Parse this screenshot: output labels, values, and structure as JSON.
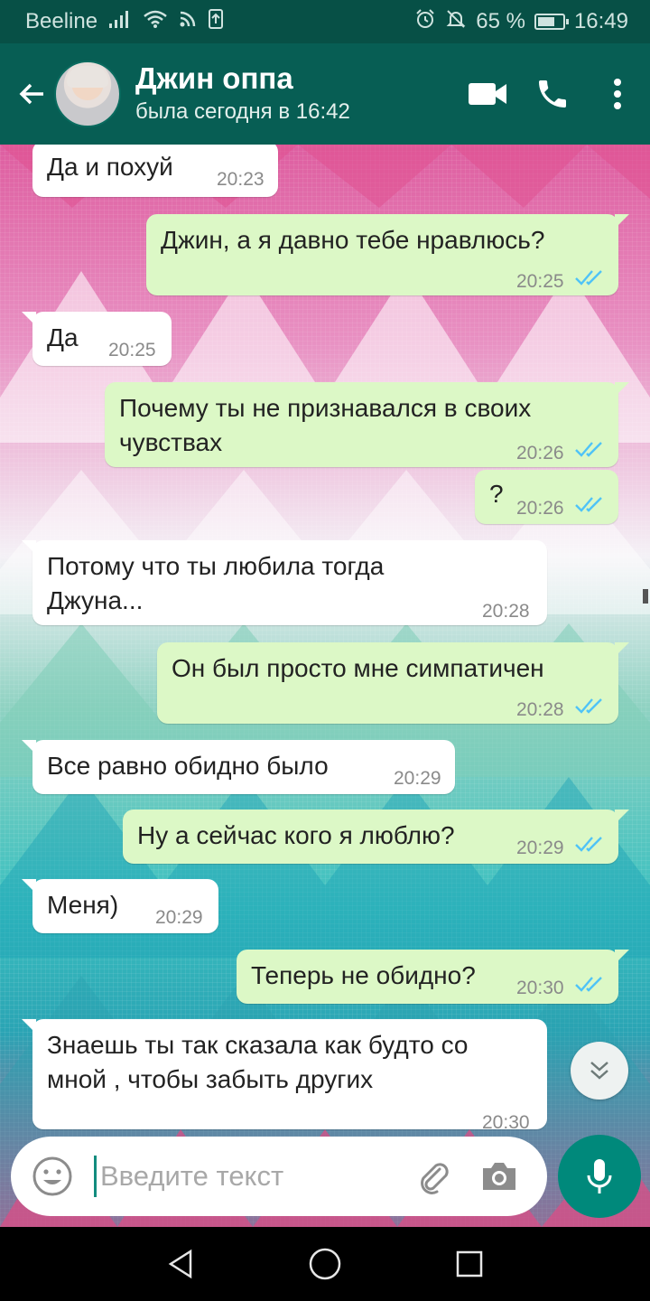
{
  "status_bar": {
    "carrier": "Beeline",
    "battery": "65 %",
    "time": "16:49"
  },
  "header": {
    "contact_name": "Джин оппа",
    "last_seen": "была сегодня в 16:42",
    "icons": [
      "back-arrow-icon",
      "video-call-icon",
      "phone-icon",
      "more-vert-icon"
    ]
  },
  "messages": [
    {
      "dir": "in",
      "text": "Да и похуй",
      "time": "20:23"
    },
    {
      "dir": "out",
      "text": "Джин, а я давно тебе нравлюсь?",
      "time": "20:25",
      "read": true
    },
    {
      "dir": "in",
      "text": "Да",
      "time": "20:25"
    },
    {
      "dir": "out",
      "text": "Почему ты не признавался в своих чувствах",
      "time": "20:26",
      "read": true
    },
    {
      "dir": "out",
      "text": "?",
      "time": "20:26",
      "read": true
    },
    {
      "dir": "in",
      "text": "Потому что ты любила тогда Джуна...",
      "time": "20:28"
    },
    {
      "dir": "out",
      "text": "Он был просто мне симпатичен",
      "time": "20:28",
      "read": true
    },
    {
      "dir": "in",
      "text": "Все равно обидно было",
      "time": "20:29"
    },
    {
      "dir": "out",
      "text": "Ну а сейчас кого я люблю?",
      "time": "20:29",
      "read": true
    },
    {
      "dir": "in",
      "text": "Меня)",
      "time": "20:29"
    },
    {
      "dir": "out",
      "text": "Теперь не обидно?",
      "time": "20:30",
      "read": true
    },
    {
      "dir": "in",
      "text": "Знаешь ты так сказала как будто со мной , чтобы забыть других",
      "time": "20:30"
    }
  ],
  "composer": {
    "placeholder": "Введите текст",
    "value": ""
  },
  "colors": {
    "header": "#075e54",
    "status_bar": "#075046",
    "outgoing_bubble": "#dcf8c6",
    "incoming_bubble": "#ffffff",
    "read_ticks": "#4fc3f7",
    "mic_button": "#00897b"
  }
}
